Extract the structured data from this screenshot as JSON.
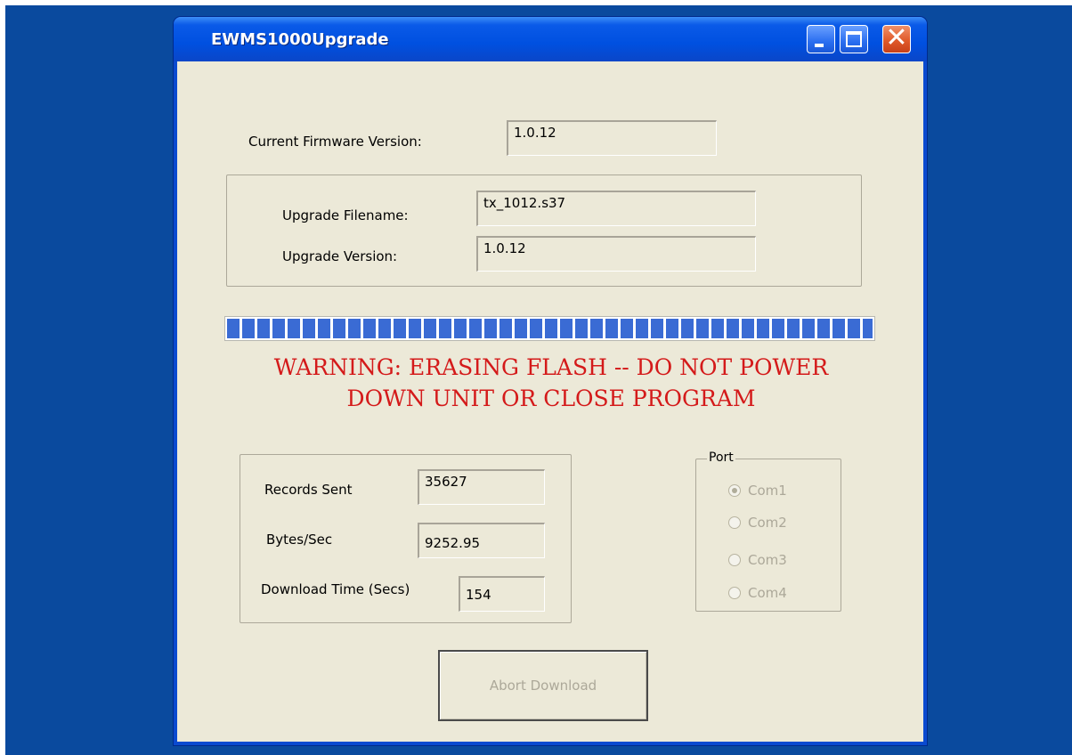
{
  "window": {
    "title": "EWMS1000Upgrade"
  },
  "firmware": {
    "current_label": "Current Firmware Version:",
    "current_value": "1.0.12"
  },
  "upgrade": {
    "filename_label": "Upgrade Filename:",
    "filename_value": "tx_1012.s37",
    "version_label": "Upgrade Version:",
    "version_value": "1.0.12"
  },
  "progress": {
    "fraction": 1.0
  },
  "warning": {
    "line1": "WARNING: ERASING FLASH -- DO NOT POWER",
    "line2": "DOWN UNIT OR CLOSE PROGRAM"
  },
  "stats": {
    "records_label": "Records Sent",
    "records_value": "35627",
    "bytes_label": "Bytes/Sec",
    "bytes_value": "9252.95",
    "time_label": "Download Time (Secs)",
    "time_value": "154"
  },
  "port": {
    "legend": "Port",
    "options": [
      {
        "label": "Com1",
        "checked": true
      },
      {
        "label": "Com2",
        "checked": false
      },
      {
        "label": "Com3",
        "checked": false
      },
      {
        "label": "Com4",
        "checked": false
      }
    ]
  },
  "abort_button": {
    "label": "Abort Download"
  },
  "colors": {
    "desktop": "#0a4a9e",
    "window_bg": "#ece9d8",
    "warning": "#d41a1a",
    "progress": "#3a6bd4"
  }
}
